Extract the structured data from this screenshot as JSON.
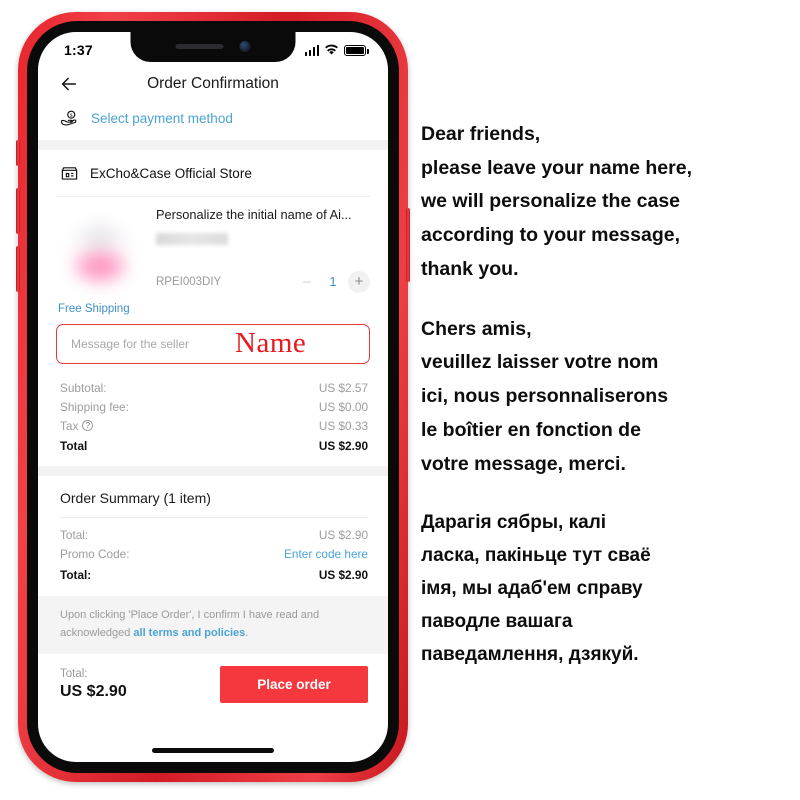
{
  "phone": {
    "status_bar": {
      "time": "1:37",
      "signal_icon": "cellular-bars-icon",
      "wifi_icon": "wifi-icon",
      "battery_icon": "battery-full-icon"
    },
    "nav": {
      "back_icon": "back-arrow-icon",
      "title": "Order Confirmation"
    },
    "payment": {
      "icon": "hand-holding-coin-icon",
      "label": "Select payment method",
      "link_color": "#4aa3d6"
    },
    "store": {
      "icon": "storefront-icon",
      "name": "ExCho&Case Official Store"
    },
    "product": {
      "image_alt": "blurred-pink-airpods-case-thumbnail",
      "title": "Personalize the initial name of Ai...",
      "variant": "blurred-variant-label",
      "sku": "RPEI003DIY",
      "qty": "1",
      "minus_label": "–",
      "plus_label": "+",
      "shipping_note": "Free Shipping"
    },
    "message_box": {
      "placeholder": "Message for the seller",
      "annotation": "Name",
      "border_color": "#e8383f",
      "annotation_color": "#e8191f"
    },
    "price_rows": [
      {
        "label": "Subtotal:",
        "value": "US $2.57",
        "bold": false,
        "help": false
      },
      {
        "label": "Shipping fee:",
        "value": "US $0.00",
        "bold": false,
        "help": false
      },
      {
        "label": "Tax",
        "value": "US $0.33",
        "bold": false,
        "help": true
      },
      {
        "label": "Total",
        "value": "US $2.90",
        "bold": true,
        "help": false
      }
    ],
    "summary": {
      "title": "Order Summary (1 item)",
      "rows": [
        {
          "label": "Total:",
          "value": "US $2.90",
          "bold": false,
          "link": false
        },
        {
          "label": "Promo Code:",
          "value": "Enter code here",
          "bold": false,
          "link": true
        },
        {
          "label": "Total:",
          "value": "US $2.90",
          "bold": true,
          "link": false
        }
      ]
    },
    "terms": {
      "prefix": "Upon clicking 'Place Order', I confirm I have read and acknowledged ",
      "link": "all terms and policies",
      "suffix": "."
    },
    "checkout": {
      "total_label": "Total:",
      "total_value": "US $2.90",
      "button_label": "Place order",
      "button_color": "#f5383e"
    }
  },
  "notes": [
    {
      "id": "english",
      "lines": [
        "Dear friends,",
        "please leave your name here,",
        "we will personalize the case",
        "according to your message,",
        "thank you."
      ]
    },
    {
      "id": "french",
      "lines": [
        "Chers amis,",
        "veuillez laisser votre nom",
        "ici, nous personnaliserons",
        "le boîtier en fonction de",
        "votre message, merci."
      ]
    },
    {
      "id": "belarusian",
      "lines": [
        "Дарагія сябры, калі",
        "ласка, пакіньце тут сваё",
        "імя, мы адаб'ем справу",
        "паводле вашага",
        "паведамлення, дзякуй."
      ]
    }
  ]
}
